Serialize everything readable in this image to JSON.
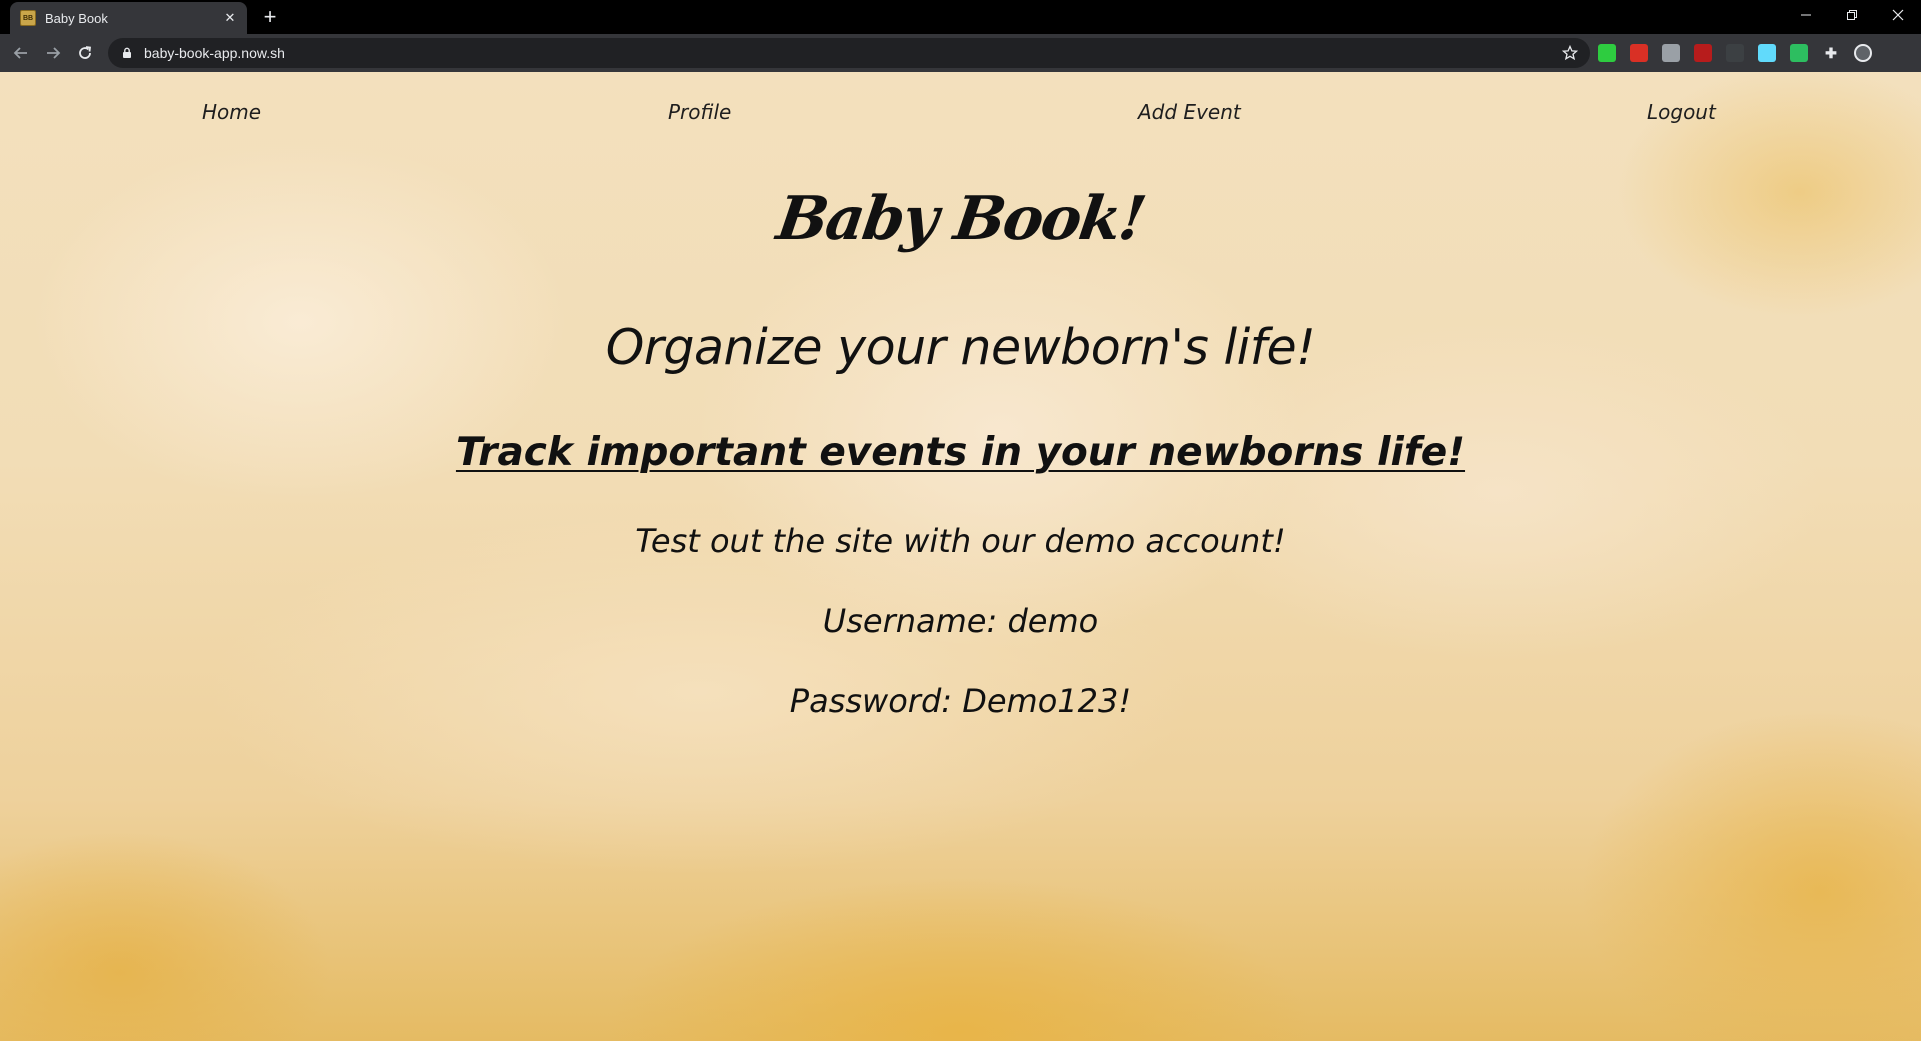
{
  "browser": {
    "tab_title": "Baby Book",
    "favicon_text": "BB",
    "url": "baby-book-app.now.sh",
    "extensions": [
      {
        "name": "green-extension-icon",
        "color": "#2ecc40"
      },
      {
        "name": "gmail-extension-icon",
        "color": "#d93025"
      },
      {
        "name": "screen-extension-icon",
        "color": "#9aa0a6"
      },
      {
        "name": "ublock-extension-icon",
        "color": "#b71c1c"
      },
      {
        "name": "pin-extension-icon",
        "color": "#3c4043"
      },
      {
        "name": "react-extension-icon",
        "color": "#61dafb"
      },
      {
        "name": "evernote-extension-icon",
        "color": "#2dbe60"
      },
      {
        "name": "puzzle-extensions-icon",
        "color": "#e8eaed"
      },
      {
        "name": "profile-avatar",
        "color": "#5f6368"
      }
    ]
  },
  "nav": {
    "home": "Home",
    "profile": "Profile",
    "add_event": "Add Event",
    "logout": "Logout"
  },
  "main": {
    "brand": "Baby Book!",
    "headline": "Organize your newborn's life!",
    "subhead": "Track important events in your newborns life!",
    "demo_intro": "Test out the site with our demo account!",
    "username_line": "Username: demo",
    "password_line": "Password: Demo123!"
  },
  "colors": {
    "chrome_dark": "#000000",
    "toolbar": "#35363a",
    "omnibox": "#202124",
    "page_text": "#111111",
    "background_warm": "#f2ddb6",
    "background_yellow": "#e5bb63"
  }
}
